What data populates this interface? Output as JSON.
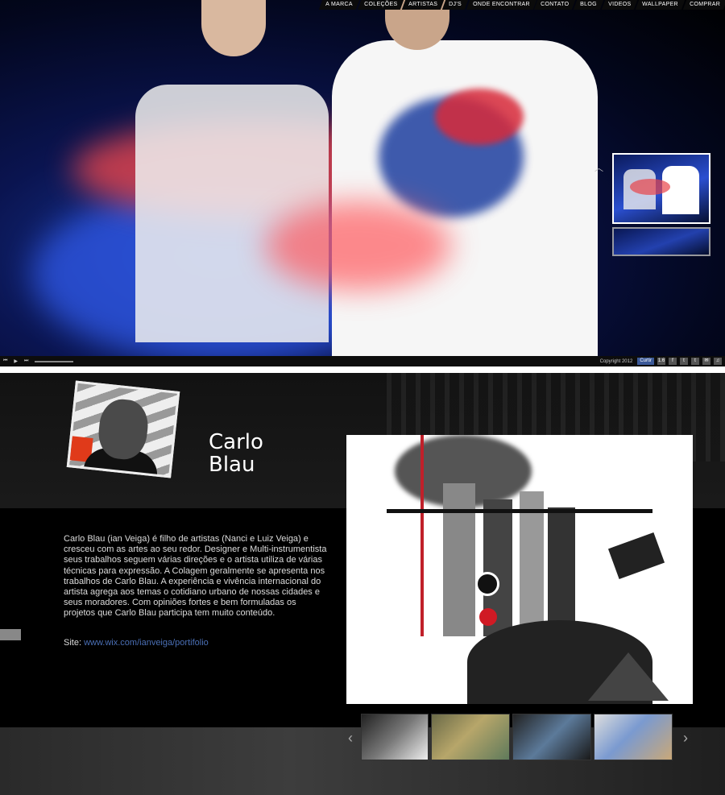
{
  "nav": {
    "items": [
      "A MARCA",
      "COLEÇÕES",
      "ARTISTAS",
      "DJ'S",
      "ONDE ENCONTRAR",
      "CONTATO",
      "BLOG",
      "VIDEOS",
      "WALLPAPER",
      "COMPRAR"
    ]
  },
  "player": {
    "prev": "⏮",
    "play": "▶",
    "next": "⏭",
    "copyright": "Copyright 2012",
    "like_label": "Curtir",
    "like_count": "1.6",
    "social": [
      "f",
      "t",
      "t",
      "✉",
      "♫"
    ]
  },
  "artist": {
    "name": "Carlo\nBlau",
    "bio": "Carlo Blau (ian Veiga) é filho de artistas (Nanci e Luiz Veiga) e cresceu com as artes ao seu redor. Designer e Multi-instrumentista seus trabalhos seguem várias direções e o artista utiliza de várias técnicas para expressão. A Colagem geralmente se apresenta nos trabalhos de Carlo Blau. A experiência e vivência internacional do artista agrega aos temas o cotidiano urbano de nossas cidades e seus moradores. Com opiniões fortes e bem formuladas os projetos que Carlo Blau participa tem muito conteúdo.",
    "site_label": "Site:",
    "site_url": "www.wix.com/ianveiga/portifolio"
  },
  "gallery": {
    "prev": "‹",
    "next": "›"
  },
  "colors": {
    "link": "#4a6fb5",
    "hero_blue": "#1b3a9c",
    "smoke_red": "#e8444a"
  }
}
